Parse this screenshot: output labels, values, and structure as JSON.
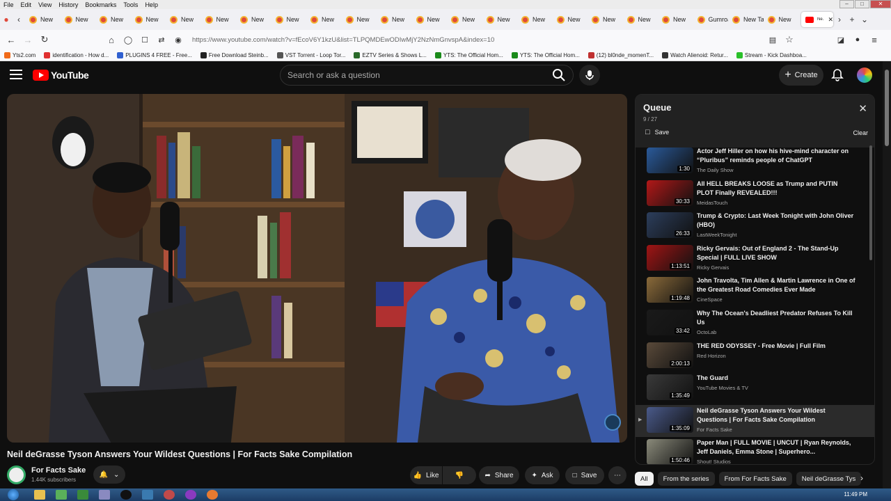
{
  "menu": [
    "File",
    "Edit",
    "View",
    "History",
    "Bookmarks",
    "Tools",
    "Help"
  ],
  "tabs": {
    "items": [
      "New",
      "New",
      "New",
      "New",
      "New",
      "New",
      "New",
      "New",
      "New",
      "New",
      "New",
      "New",
      "New",
      "New",
      "New",
      "New",
      "New",
      "New",
      "New",
      "Gumroad",
      "New Tab",
      "New"
    ],
    "active_label": "Ne... Ri..."
  },
  "address": {
    "url": "https://www.youtube.com/watch?v=fEcoV6Y1kzU&list=TLPQMDEwODIwMjY2NzNmGnvspA&index=10"
  },
  "bookmarks": [
    "Yts2.com",
    "identification - How d...",
    "PLUGINS 4 FREE - Free...",
    "Free Download Steinb...",
    "VST Torrent - Loop Tor...",
    "EZTV Series & Shows L...",
    "YTS: The Official Hom...",
    "YTS: The Official Hom...",
    "(12) bl0nde_momenT...",
    "Watch Alienoid: Retur...",
    "Stream - Kick Dashboa..."
  ],
  "yt": {
    "logo": "YouTube",
    "search_placeholder": "Search or ask a question",
    "create": "Create"
  },
  "video": {
    "title": "Neil deGrasse Tyson Answers Your Wildest Questions | For Facts Sake Compilation",
    "channel": "For Facts Sake",
    "subscribers": "1.44K subscribers",
    "actions": {
      "like": "Like",
      "share": "Share",
      "ask": "Ask",
      "save": "Save"
    }
  },
  "queue": {
    "title": "Queue",
    "count": "9 / 27",
    "save": "Save",
    "clear": "Clear",
    "items": [
      {
        "title": "Actor Jeff Hiller on how his hive-mind character on “Pluribus” reminds people of ChatGPT",
        "channel": "The Daily Show",
        "duration": "1:30",
        "color": "#2a5a9a"
      },
      {
        "title": "All HELL BREAKS LOOSE as Trump and PUTIN PLOT Finally REVEALED!!!",
        "channel": "MeidasTouch",
        "duration": "30:33",
        "color": "#b21818"
      },
      {
        "title": "Trump & Crypto: Last Week Tonight with John Oliver (HBO)",
        "channel": "LastWeekTonight",
        "duration": "26:33",
        "color": "#2c3e5c"
      },
      {
        "title": "Ricky Gervais: Out of England 2 - The Stand-Up Special | FULL LIVE SHOW",
        "channel": "Ricky Gervais",
        "duration": "1:13:51",
        "color": "#a01414"
      },
      {
        "title": "John Travolta, Tim Allen & Martin Lawrence in One of the Greatest Road Comedies Ever Made",
        "channel": "CineSpace",
        "duration": "1:19:48",
        "color": "#8a6a3a"
      },
      {
        "title": "Why The Ocean's Deadliest Predator Refuses To Kill Us",
        "channel": "OctoLab",
        "duration": "33:42",
        "color": "#1a1a1a"
      },
      {
        "title": "THE RED ODYSSEY - Free Movie | Full Film",
        "channel": "Red Horizon",
        "duration": "2:00:13",
        "color": "#5a4a3a"
      },
      {
        "title": "The Guard",
        "channel": "YouTube Movies & TV",
        "duration": "1:35:49",
        "color": "#3a3a3a"
      },
      {
        "title": "Neil deGrasse Tyson Answers Your Wildest Questions | For Facts Sake Compilation",
        "channel": "For Facts Sake",
        "duration": "1:35:09",
        "color": "#4a5a8a"
      },
      {
        "title": "Paper Man | FULL MOVIE | UNCUT | Ryan Reynolds, Jeff Daniels, Emma Stone | Superhero...",
        "channel": "Shout! Studios",
        "duration": "1:50:46",
        "color": "#8a8a7a"
      }
    ]
  },
  "chips": [
    "All",
    "From the series",
    "From For Facts Sake",
    "Neil deGrasse Tys"
  ],
  "taskbar": {
    "clock": "11:49 PM"
  }
}
